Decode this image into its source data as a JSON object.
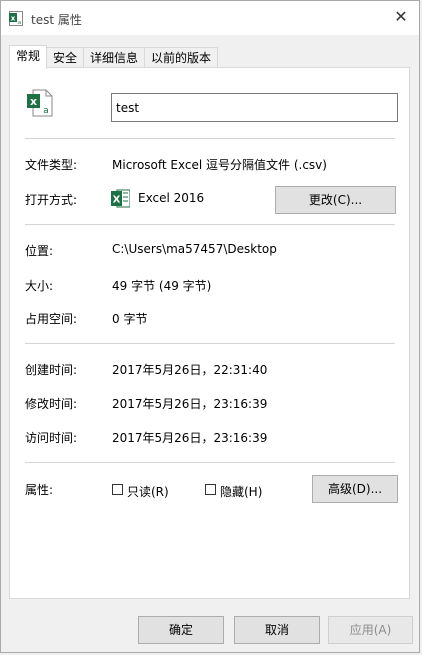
{
  "window": {
    "title": "test 属性",
    "close_glyph": "✕"
  },
  "tabs": [
    {
      "label": "常规",
      "active": true
    },
    {
      "label": "安全",
      "active": false
    },
    {
      "label": "详细信息",
      "active": false
    },
    {
      "label": "以前的版本",
      "active": false
    }
  ],
  "general": {
    "file_name": "test",
    "rows": {
      "file_type": {
        "label": "文件类型:",
        "value": "Microsoft Excel 逗号分隔值文件 (.csv)"
      },
      "opens_with": {
        "label": "打开方式:",
        "value": "Excel 2016",
        "change_button": "更改(C)..."
      },
      "location": {
        "label": "位置:",
        "value": "C:\\Users\\ma57457\\Desktop"
      },
      "size": {
        "label": "大小:",
        "value": "49 字节 (49 字节)"
      },
      "size_on_disk": {
        "label": "占用空间:",
        "value": "0 字节"
      },
      "created": {
        "label": "创建时间:",
        "value": "2017年5月26日，22:31:40"
      },
      "modified": {
        "label": "修改时间:",
        "value": "2017年5月26日，23:16:39"
      },
      "accessed": {
        "label": "访问时间:",
        "value": "2017年5月26日，23:16:39"
      }
    },
    "attributes": {
      "label": "属性:",
      "readonly": {
        "label": "只读(R)",
        "checked": false
      },
      "hidden": {
        "label": "隐藏(H)",
        "checked": false
      },
      "advanced_button": "高级(D)..."
    }
  },
  "footer": {
    "ok": "确定",
    "cancel": "取消",
    "apply": "应用(A)"
  },
  "colors": {
    "excel_green": "#1e7145",
    "border": "#adadad",
    "button_bg": "#e1e1e1"
  }
}
